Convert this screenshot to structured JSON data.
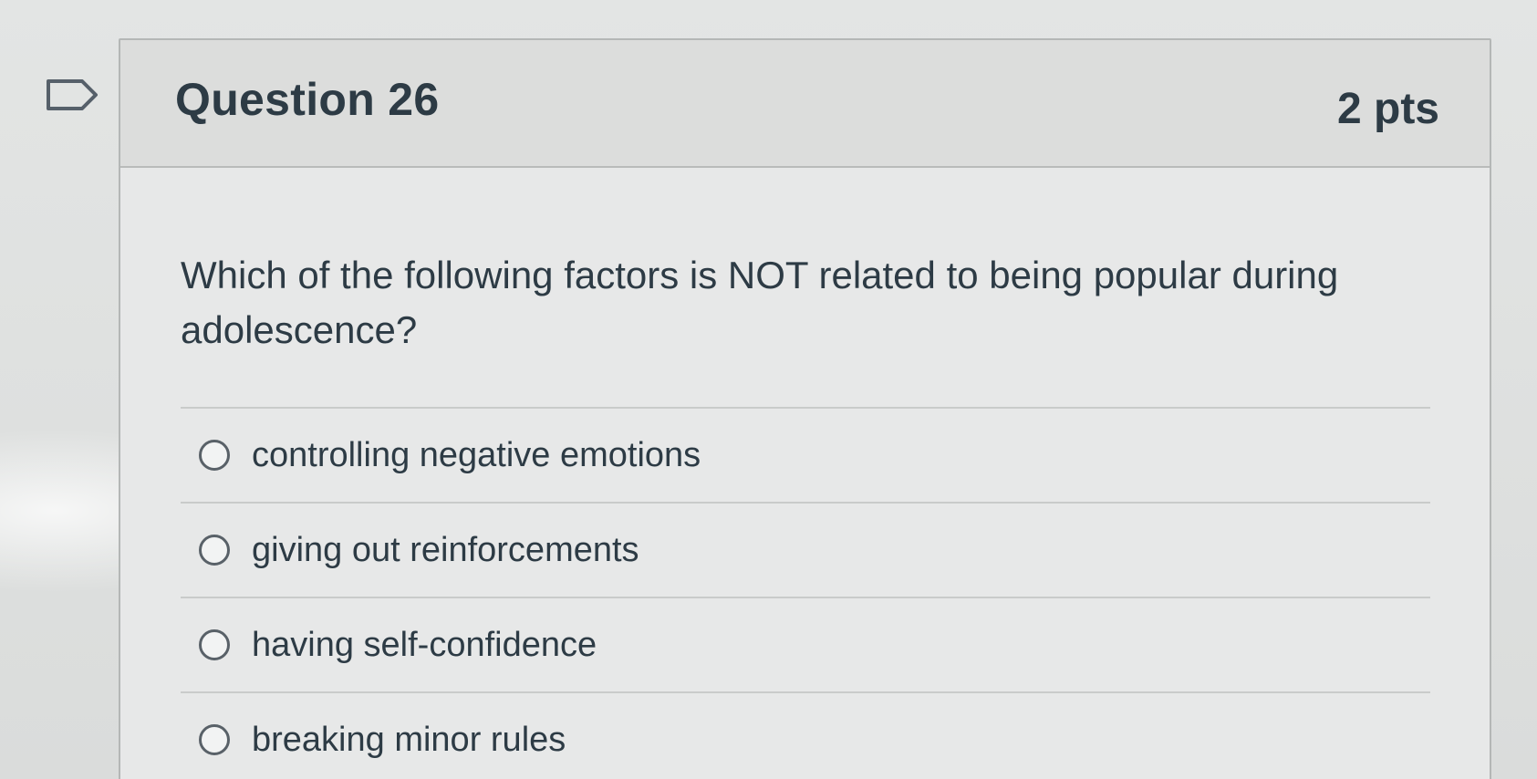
{
  "question": {
    "title": "Question 26",
    "points": "2 pts",
    "text": "Which of the following factors is NOT related to being popular during adolescence?",
    "flag_icon": "flag-outline-icon",
    "answers": [
      {
        "label": "controlling negative emotions",
        "selected": false
      },
      {
        "label": "giving out reinforcements",
        "selected": false
      },
      {
        "label": "having self-confidence",
        "selected": false
      },
      {
        "label": "breaking minor rules",
        "selected": false
      }
    ]
  },
  "colors": {
    "text": "#2d3b45",
    "header_bg": "#dcdddc",
    "card_bg": "#e7e8e8",
    "border": "#b4b7b6"
  }
}
